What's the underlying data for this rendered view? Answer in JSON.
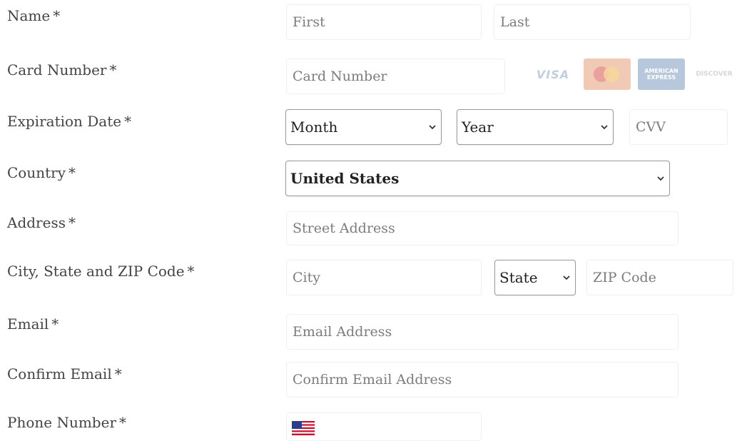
{
  "form": {
    "required_marker": "*",
    "name": {
      "label": "Name",
      "first_placeholder": "First",
      "last_placeholder": "Last"
    },
    "card_number": {
      "label": "Card Number",
      "placeholder": "Card Number",
      "logos": [
        {
          "icon": "visa-logo",
          "text": "VISA"
        },
        {
          "icon": "mastercard-logo",
          "text": ""
        },
        {
          "icon": "amex-logo",
          "text": "AMERICAN EXPRESS"
        },
        {
          "icon": "discover-logo",
          "text": "DISCOVER"
        }
      ]
    },
    "expiration": {
      "label": "Expiration Date",
      "month_value": "Month",
      "year_value": "Year",
      "cvv_placeholder": "CVV"
    },
    "country": {
      "label": "Country",
      "value": "United States"
    },
    "address": {
      "label": "Address",
      "placeholder": "Street Address"
    },
    "city_state_zip": {
      "label": "City, State and ZIP Code",
      "city_placeholder": "City",
      "state_value": "State",
      "zip_placeholder": "ZIP Code"
    },
    "email": {
      "label": "Email",
      "placeholder": "Email Address"
    },
    "confirm_email": {
      "label": "Confirm Email",
      "placeholder": "Confirm Email Address"
    },
    "phone": {
      "label": "Phone Number",
      "country_flag": "us-flag-icon"
    }
  },
  "colors": {
    "label_text": "#444444",
    "placeholder_text": "#7c7c7c",
    "input_border": "#f0f0f0",
    "select_border": "#9a9a9a"
  }
}
